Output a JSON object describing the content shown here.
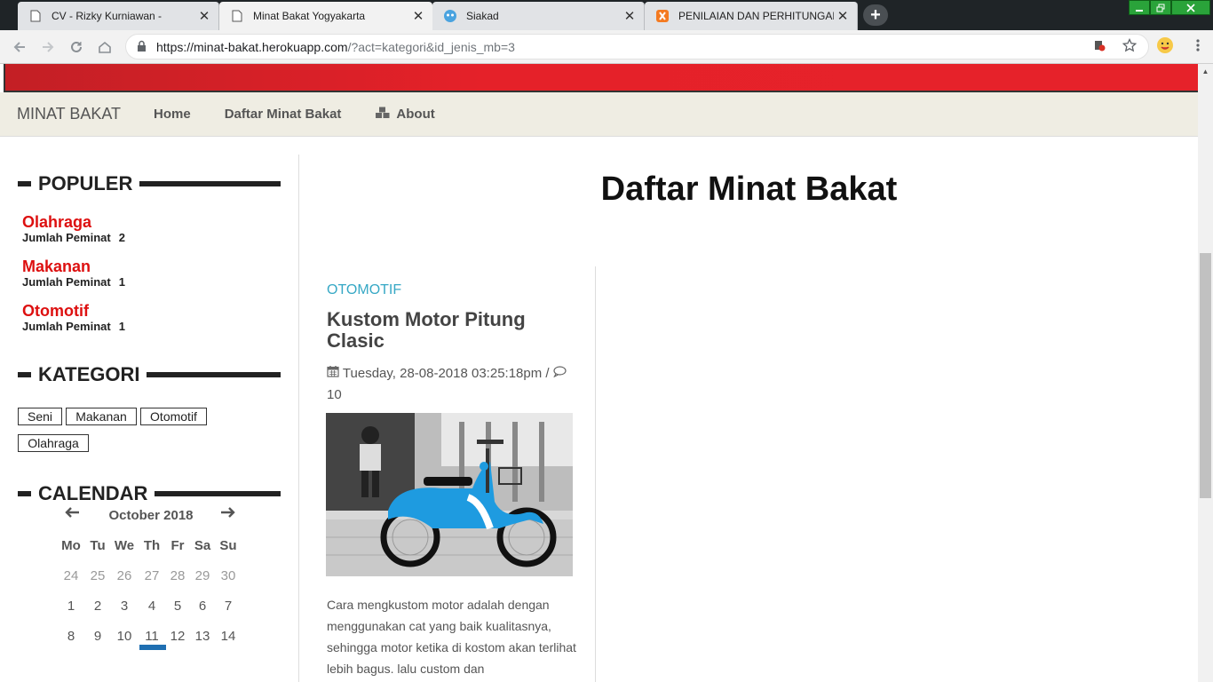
{
  "browser": {
    "tabs": [
      {
        "title": "CV - Rizky Kurniawan -",
        "icon": "page-icon",
        "active": false
      },
      {
        "title": "Minat Bakat Yogyakarta",
        "icon": "page-icon",
        "active": true
      },
      {
        "title": "Siakad",
        "icon": "siakad-icon",
        "active": false
      },
      {
        "title": "PENILAIAN DAN PERHITUNGAN",
        "icon": "xampp-icon",
        "active": false
      }
    ],
    "url_host": "https://minat-bakat.herokuapp.com",
    "url_rest": "/?act=kategori&id_jenis_mb=3"
  },
  "nav": {
    "brand": "MINAT BAKAT",
    "home": "Home",
    "daftar": "Daftar Minat Bakat",
    "about": "About"
  },
  "sidebar": {
    "populer_title": "POPULER",
    "populer": [
      {
        "name": "Olahraga",
        "label": "Jumlah Peminat",
        "count": "2"
      },
      {
        "name": "Makanan",
        "label": "Jumlah Peminat",
        "count": "1"
      },
      {
        "name": "Otomotif",
        "label": "Jumlah Peminat",
        "count": "1"
      }
    ],
    "kategori_title": "KATEGORI",
    "kategori": [
      "Seni",
      "Makanan",
      "Otomotif",
      "Olahraga"
    ],
    "calendar_title": "CALENDAR",
    "calendar": {
      "month": "October 2018",
      "days": [
        "Mo",
        "Tu",
        "We",
        "Th",
        "Fr",
        "Sa",
        "Su"
      ],
      "week1": [
        "24",
        "25",
        "26",
        "27",
        "28",
        "29",
        "30"
      ],
      "week2": [
        "1",
        "2",
        "3",
        "4",
        "5",
        "6",
        "7"
      ],
      "week3": [
        "8",
        "9",
        "10",
        "11",
        "12",
        "13",
        "14"
      ]
    }
  },
  "main": {
    "title": "Daftar Minat Bakat",
    "post": {
      "category": "OTOMOTIF",
      "title": "Kustom Motor Pitung Clasic",
      "date": "Tuesday, 28-08-2018 03:25:18pm /",
      "comments": "10",
      "excerpt": "Cara mengkustom motor adalah dengan menggunakan cat yang baik kualitasnya, sehingga motor ketika di kostom akan terlihat lebih bagus. lalu custom dan"
    }
  }
}
